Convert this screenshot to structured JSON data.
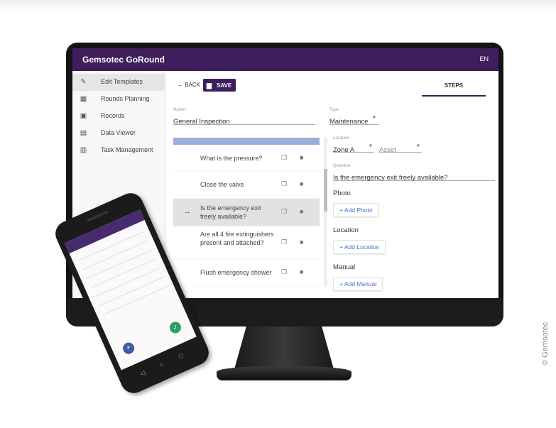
{
  "app": {
    "title": "Gemsotec GoRound",
    "language": "EN"
  },
  "sidebar": {
    "items": [
      {
        "label": "Edit Templates",
        "icon": "pencil-icon"
      },
      {
        "label": "Rounds Planning",
        "icon": "calendar-icon"
      },
      {
        "label": "Records",
        "icon": "calendar-check-icon"
      },
      {
        "label": "Data Viewer",
        "icon": "data-viewer-icon"
      },
      {
        "label": "Task Management",
        "icon": "task-icon"
      }
    ]
  },
  "toolbar": {
    "back_label": "← BACK",
    "save_label": "SAVE",
    "steps_tab": "STEPS"
  },
  "form": {
    "name_label": "Name*",
    "name_value": "General Inspection",
    "type_label": "Type",
    "type_value": "Maintenance"
  },
  "steps": [
    {
      "text": "What is the pressure?",
      "selected": false
    },
    {
      "text": "Close the valve",
      "selected": false
    },
    {
      "text": "Is the emergency exit freely available?",
      "selected": true
    },
    {
      "text": "Are all 4 fire extinguishers present and attached?",
      "selected": false
    },
    {
      "text": "Flush emergency shower",
      "selected": false
    }
  ],
  "detail": {
    "location_label": "Location",
    "location_value": "Zone A",
    "asset_value": "Asset",
    "question_label": "Question",
    "question_value": "Is the emergency exit freely available?",
    "photo_title": "Photo",
    "photo_button": "+ Add Photo",
    "location_title": "Location",
    "location_button": "+ Add Location",
    "manual_title": "Manual",
    "manual_button": "+ Add Manual"
  },
  "credit": "© Gemsotec"
}
